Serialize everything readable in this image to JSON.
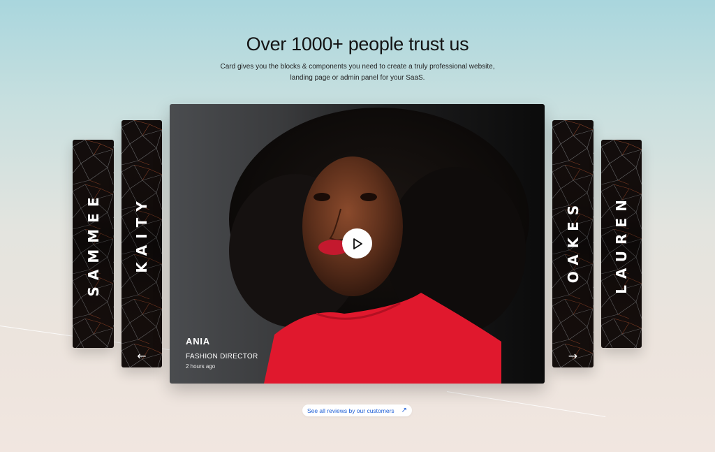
{
  "header": {
    "title": "Over 1000+ people trust us",
    "subtitle": "Card gives you the blocks & components you need to create a truly professional website, landing page or admin panel for your SaaS."
  },
  "carousel": {
    "left_cards": [
      {
        "name": "SAMMEE"
      },
      {
        "name": "KAITY"
      }
    ],
    "right_cards": [
      {
        "name": "OAKES"
      },
      {
        "name": "LAUREN"
      }
    ],
    "prev_icon": "arrow-left-icon",
    "next_icon": "arrow-right-icon",
    "featured": {
      "name": "ANIA",
      "role": "FASHION DIRECTOR",
      "time": "2 hours ago",
      "play_icon": "play-icon"
    }
  },
  "footer": {
    "link_label": "See all reviews by our customers",
    "link_icon": "external-arrow-icon"
  },
  "colors": {
    "accent_link": "#1f5fd6",
    "card_dark": "#120d0c",
    "shirt_red": "#e0182d"
  }
}
